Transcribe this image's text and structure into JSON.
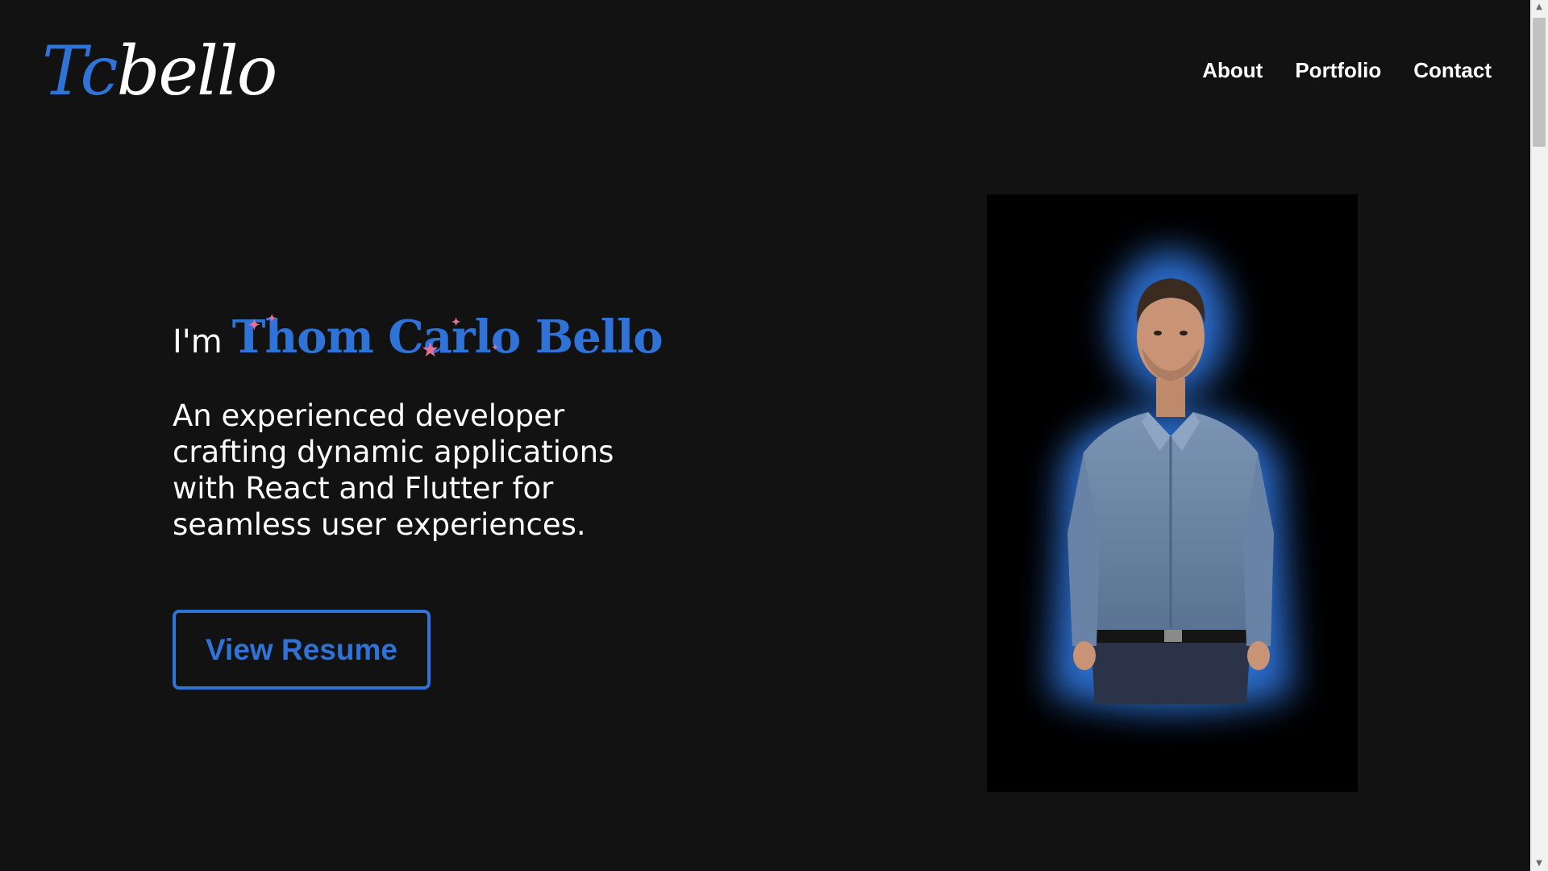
{
  "header": {
    "logo": {
      "initials": "Tc",
      "rest": "bello"
    },
    "nav": {
      "items": [
        {
          "label": "About"
        },
        {
          "label": "Portfolio"
        },
        {
          "label": "Contact"
        }
      ]
    }
  },
  "hero": {
    "intro_prefix": "I'm",
    "name": "Thom Carlo Bello",
    "description": "An experienced developer crafting dynamic applications with React and Flutter for seamless user experiences.",
    "resume_button_label": "View Resume"
  },
  "portrait": {
    "glow_color": "#2f73d8"
  },
  "colors": {
    "accent": "#2f73d8",
    "background": "#121212",
    "text": "#ffffff",
    "sparkle": "#e4709a"
  }
}
